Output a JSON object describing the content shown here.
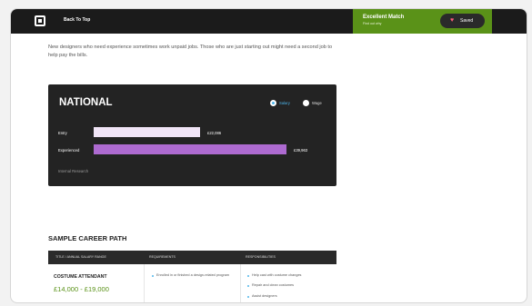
{
  "header": {
    "back_label": "Back To Top",
    "match_title": "Excellent Match",
    "match_sub": "Find out why",
    "saved_label": "Saved"
  },
  "intro": "New designers who need experience sometimes work unpaid jobs. Those who are just starting out might need a second job to help pay the bills.",
  "national": {
    "title": "NATIONAL",
    "salary_label": "Salary",
    "wage_label": "Wage",
    "selected": "Salary",
    "entry_label": "Entry",
    "entry_value": "£22,086",
    "entry_amount": 22086,
    "experienced_label": "Experienced",
    "experienced_value": "£39,963",
    "experienced_amount": 39963,
    "source": "Internal Research",
    "colors": {
      "entry_bar": "#f0e4f6",
      "experienced_bar": "#ad6ad0",
      "accent": "#4db5ea"
    }
  },
  "career_path": {
    "title": "SAMPLE CAREER PATH",
    "headers": [
      "TITLE / ANNUAL SALARY RANGE",
      "REQUIREMENTS",
      "RESPONSIBILITIES"
    ],
    "row": {
      "title": "COSTUME ATTENDANT",
      "range": "£14,000 - £19,000",
      "requirements": [
        "Enrolled in or finished a design-related program"
      ],
      "responsibilities": [
        "Help cast with costume changes",
        "Repair and clean costumes",
        "Assist designers"
      ]
    }
  },
  "colors": {
    "topbar": "#1b1b1b",
    "match_green": "#5a9218",
    "heart": "#ff5a7a"
  }
}
